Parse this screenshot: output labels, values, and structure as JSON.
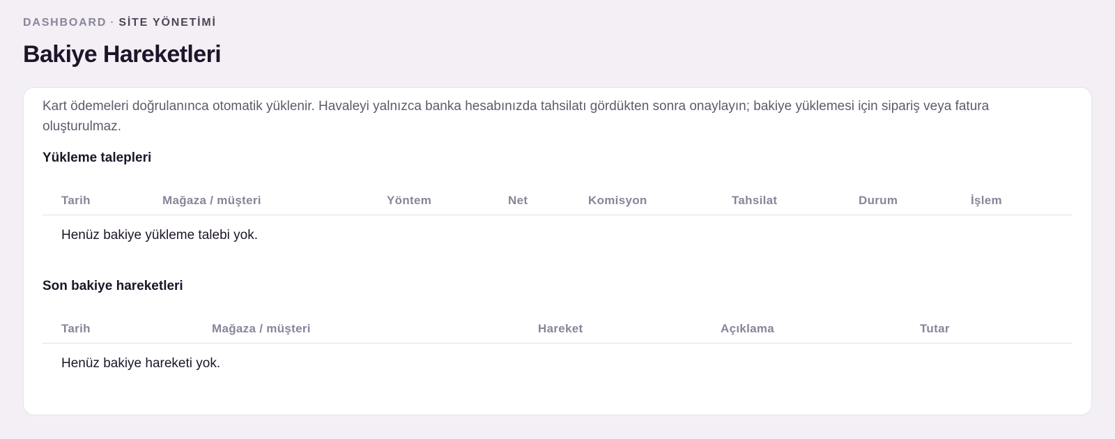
{
  "breadcrumb": {
    "root": "DASHBOARD",
    "separator": "·",
    "current": "SİTE YÖNETİMİ"
  },
  "page": {
    "title": "Bakiye Hareketleri"
  },
  "intro": "Kart ödemeleri doğrulanınca otomatik yüklenir. Havaleyi yalnızca banka hesabınızda tahsilatı gördükten sonra onaylayın; bakiye yüklemesi için sipariş veya fatura oluşturulmaz.",
  "topup_requests": {
    "title": "Yükleme talepleri",
    "columns": [
      "Tarih",
      "Mağaza / müşteri",
      "Yöntem",
      "Net",
      "Komisyon",
      "Tahsilat",
      "Durum",
      "İşlem"
    ],
    "empty": "Henüz bakiye yükleme talebi yok."
  },
  "recent_movements": {
    "title": "Son bakiye hareketleri",
    "columns": [
      "Tarih",
      "Mağaza / müşteri",
      "Hareket",
      "Açıklama",
      "Tutar"
    ],
    "empty": "Henüz bakiye hareketi yok."
  },
  "colors": {
    "background": "#f3eff5",
    "card": "#ffffff",
    "header_text": "#8a8499",
    "title_text": "#1d1528"
  }
}
